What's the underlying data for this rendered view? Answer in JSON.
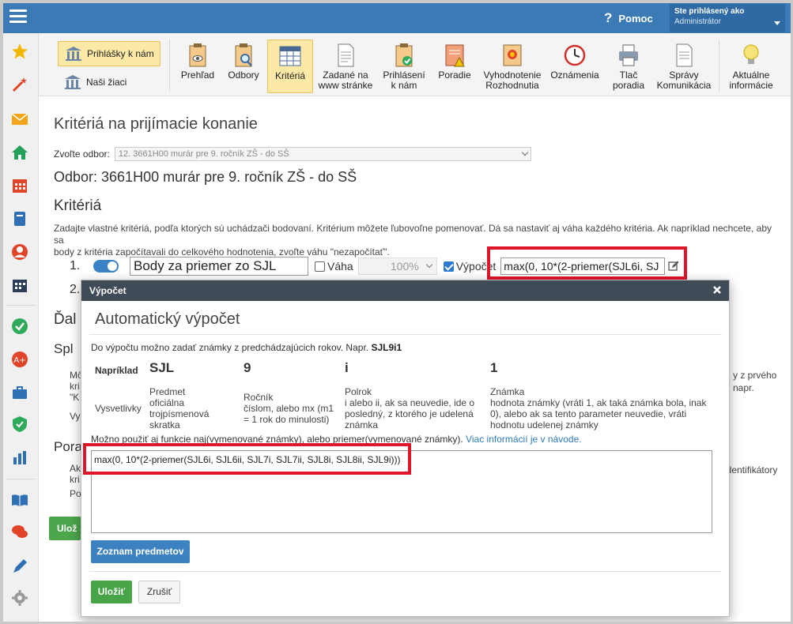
{
  "topbar": {
    "help_label": "Pomoc",
    "user_line1": "Ste prihlásený ako",
    "user_line2": "Administrátor"
  },
  "toolbar": {
    "left_buttons": [
      {
        "label": "Prihlášky k nám",
        "active": true
      },
      {
        "label": "Naši žiaci",
        "active": false
      }
    ],
    "items": [
      {
        "l1": "Prehľad",
        "l2": ""
      },
      {
        "l1": "Odbory",
        "l2": ""
      },
      {
        "l1": "Kritériá",
        "l2": ""
      },
      {
        "l1": "Zadané na",
        "l2": "www stránke"
      },
      {
        "l1": "Prihlásení",
        "l2": "k nám"
      },
      {
        "l1": "Poradie",
        "l2": ""
      },
      {
        "l1": "Vyhodnotenie",
        "l2": "Rozhodnutia"
      },
      {
        "l1": "Oznámenia",
        "l2": ""
      },
      {
        "l1": "Tlač",
        "l2": "poradia"
      },
      {
        "l1": "Správy",
        "l2": "Komunikácia"
      },
      {
        "l1": "Aktuálne",
        "l2": "informácie"
      }
    ]
  },
  "page": {
    "title": "Kritériá na prijímacie konanie",
    "odbor_label": "Zvoľte odbor:",
    "odbor_value": "12. 3661H00 murár pre 9. ročník ZŠ - do SŠ",
    "odbor_heading": "Odbor: 3661H00 murár pre 9. ročník ZŠ - do SŠ",
    "kriteria_heading": "Kritériá",
    "kriteria_desc_1": "Zadajte vlastné kritériá, podľa ktorých sú uchádzači bodovaní. Kritérium môžete ľubovoľne pomenovať. Dá sa nastaviť aj váha každého kritéria. Ak napríklad nechcete, aby sa",
    "kriteria_desc_2": "body z kritéria započítavali do celkového hodnotenia, zvoľte váhu \"nezapočítať\".",
    "row1_num": "1.",
    "row1_name": "Body za priemer zo SJL",
    "vaha_label": "Váha",
    "vaha_value": "100%",
    "vypocet_label": "Výpočet",
    "row1_formula": "max(0, 10*(2-priemer(SJL6i, SJ",
    "row2_num": "2.",
    "dal_label": "Ďal",
    "spl_label": "Spl",
    "mo_label": "Mô",
    "kri_label": "kri",
    "k_label": "\"K",
    "vy_label": "Vy",
    "por_label": "Pora",
    "ak_label": "Ak",
    "kri2_label": "kri",
    "po_label": "Po",
    "right_1": "y z prvého",
    "right_2": "napr.",
    "right_3": "é identifikátory",
    "save_bg": "Ulož"
  },
  "modal": {
    "header": "Výpočet",
    "title": "Automatický výpočet",
    "intro": "Do výpočtu možno zadať známky z predchádzajúcich rokov. Napr.",
    "intro_example": "SJL9i1",
    "example_label": "Napríklad",
    "ex_predmet": "SJL",
    "ex_rocnik": "9",
    "ex_polrok": "i",
    "ex_znamka": "1",
    "vysvetlivky": "Vysvetlivky",
    "predmet_hd": "Predmet",
    "predmet_1": "oficiálna",
    "predmet_2": "trojpísmenová",
    "predmet_3": "skratka",
    "rocnik_hd": "Ročník",
    "rocnik_1": "číslom, alebo mx (m1",
    "rocnik_2": "= 1 rok do minulosti)",
    "polrok_hd": "Polrok",
    "polrok_1": "i alebo ii, ak sa neuvedie, ide o",
    "polrok_2": "posledný, z ktorého je udelená",
    "polrok_3": "známka",
    "znamka_hd": "Známka",
    "znamka_1": "hodnota známky (vráti 1, ak taká známka bola, inak",
    "znamka_2": "0), alebo ak sa tento parameter neuvedie, vráti",
    "znamka_3": "hodnotu udelenej známky",
    "note": "Možno použiť aj funkcie naj(vymenované známky), alebo priemer(vymenované známky).",
    "note_link": "Viac informácií je v návode.",
    "formula": "max(0, 10*(2-priemer(SJL6i, SJL6ii, SJL7i, SJL7ii, SJL8i, SJL8ii, SJL9i)))",
    "subjects_btn": "Zoznam predmetov",
    "save_btn": "Uložiť",
    "cancel_btn": "Zrušiť"
  },
  "colors": {
    "topbar": "#3c7ab6",
    "active_tab": "#fde9a6",
    "highlight": "#e0152a",
    "modal_header": "#3f4b57"
  }
}
